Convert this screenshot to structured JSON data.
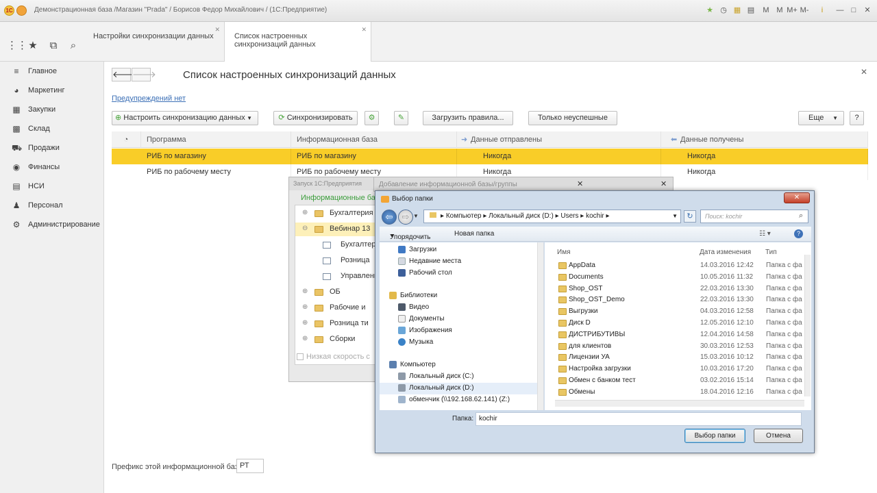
{
  "window": {
    "title": "Демонстрационная база /Магазин \"Prada\" / Борисов Федор Михайлович /  (1С:Предприятие)",
    "logo": "1С"
  },
  "titlebar_icons": [
    "М",
    "М",
    "М+",
    "М-",
    "i",
    "—",
    "□",
    "✕"
  ],
  "tabs": [
    {
      "label": "Настройки синхронизации данных"
    },
    {
      "label": "Список настроенных синхронизаций данных"
    }
  ],
  "sidebar": {
    "items": [
      {
        "label": "Главное",
        "icon": "menu-icon"
      },
      {
        "label": "Маркетинг",
        "icon": "pie-chart-icon"
      },
      {
        "label": "Закупки",
        "icon": "purchases-icon"
      },
      {
        "label": "Склад",
        "icon": "warehouse-icon"
      },
      {
        "label": "Продажи",
        "icon": "sales-icon"
      },
      {
        "label": "Финансы",
        "icon": "finance-icon"
      },
      {
        "label": "НСИ",
        "icon": "reference-icon"
      },
      {
        "label": "Персонал",
        "icon": "person-icon"
      },
      {
        "label": "Администрирование",
        "icon": "gear-icon"
      }
    ]
  },
  "main": {
    "title": "Список настроенных синхронизаций данных",
    "warnings_link": "Предупреждений нет",
    "buttons": {
      "setup": "Настроить синхронизацию данных",
      "sync": "Синхронизировать",
      "load_rules": "Загрузить правила...",
      "only_failed": "Только неуспешные",
      "more": "Еще",
      "help": "?"
    },
    "table": {
      "headers": [
        "Программа",
        "Информационная база",
        "Данные отправлены",
        "Данные получены"
      ],
      "rows": [
        [
          "РИБ по магазину",
          "РИБ по магазину",
          "Никогда",
          "Никогда"
        ],
        [
          "РИБ по рабочему месту",
          "РИБ по рабочему месту",
          "Никогда",
          "Никогда"
        ]
      ]
    },
    "prefix_label": "Префикс этой информационной базы:",
    "prefix_value": "РТ"
  },
  "launch_dialog": {
    "title": "Запуск 1С:Предприятия",
    "section": "Информационные базы",
    "items": [
      "Бухгалтерия",
      "Вебинар 13",
      "Бухгалтерия",
      "Розница",
      "Управление",
      "ОБ",
      "Рабочие и",
      "Розница ти",
      "Сборки"
    ],
    "low_speed": "Низкая скорость с"
  },
  "add_dialog": {
    "title": "Добавление информационной базы/группы"
  },
  "picker": {
    "title": "Выбор папки",
    "address": [
      "Компьютер",
      "Локальный диск (D:)",
      "Users",
      "kochir"
    ],
    "search_placeholder": "Поиск: kochir",
    "organize": "Упорядочить",
    "new_folder": "Новая папка",
    "nav": {
      "quick": [
        "Загрузки",
        "Недавние места",
        "Рабочий стол"
      ],
      "libraries": "Библиотеки",
      "libs": [
        "Видео",
        "Документы",
        "Изображения",
        "Музыка"
      ],
      "computer": "Компьютер",
      "drives": [
        "Локальный диск (C:)",
        "Локальный диск (D:)",
        "обменчик (\\\\192.168.62.141) (Z:)"
      ]
    },
    "columns": [
      "Имя",
      "Дата изменения",
      "Тип"
    ],
    "files": [
      [
        "AppData",
        "14.03.2016 12:42",
        "Папка с фа"
      ],
      [
        "Documents",
        "10.05.2016 11:32",
        "Папка с фа"
      ],
      [
        "Shop_OST",
        "22.03.2016 13:30",
        "Папка с фа"
      ],
      [
        "Shop_OST_Demo",
        "22.03.2016 13:30",
        "Папка с фа"
      ],
      [
        "Выгрузки",
        "04.03.2016 12:58",
        "Папка с фа"
      ],
      [
        "Диск D",
        "12.05.2016 12:10",
        "Папка с фа"
      ],
      [
        "ДИСТРИБУТИВЫ",
        "12.04.2016 14:58",
        "Папка с фа"
      ],
      [
        "для клиентов",
        "30.03.2016 12:53",
        "Папка с фа"
      ],
      [
        "Лицензии УА",
        "15.03.2016 10:12",
        "Папка с фа"
      ],
      [
        "Настройка загрузки",
        "10.03.2016 17:20",
        "Папка с фа"
      ],
      [
        "Обмен с банком тест",
        "03.02.2016 15:14",
        "Папка с фа"
      ],
      [
        "Обмены",
        "18.04.2016 12:16",
        "Папка с фа"
      ]
    ],
    "folder_label": "Папка:",
    "folder_value": "kochir",
    "ok": "Выбор папки",
    "cancel": "Отмена"
  },
  "colors": {
    "selected_row": "#f9cd28",
    "link": "#3b6fb6",
    "section_green": "#3a9d3a"
  }
}
